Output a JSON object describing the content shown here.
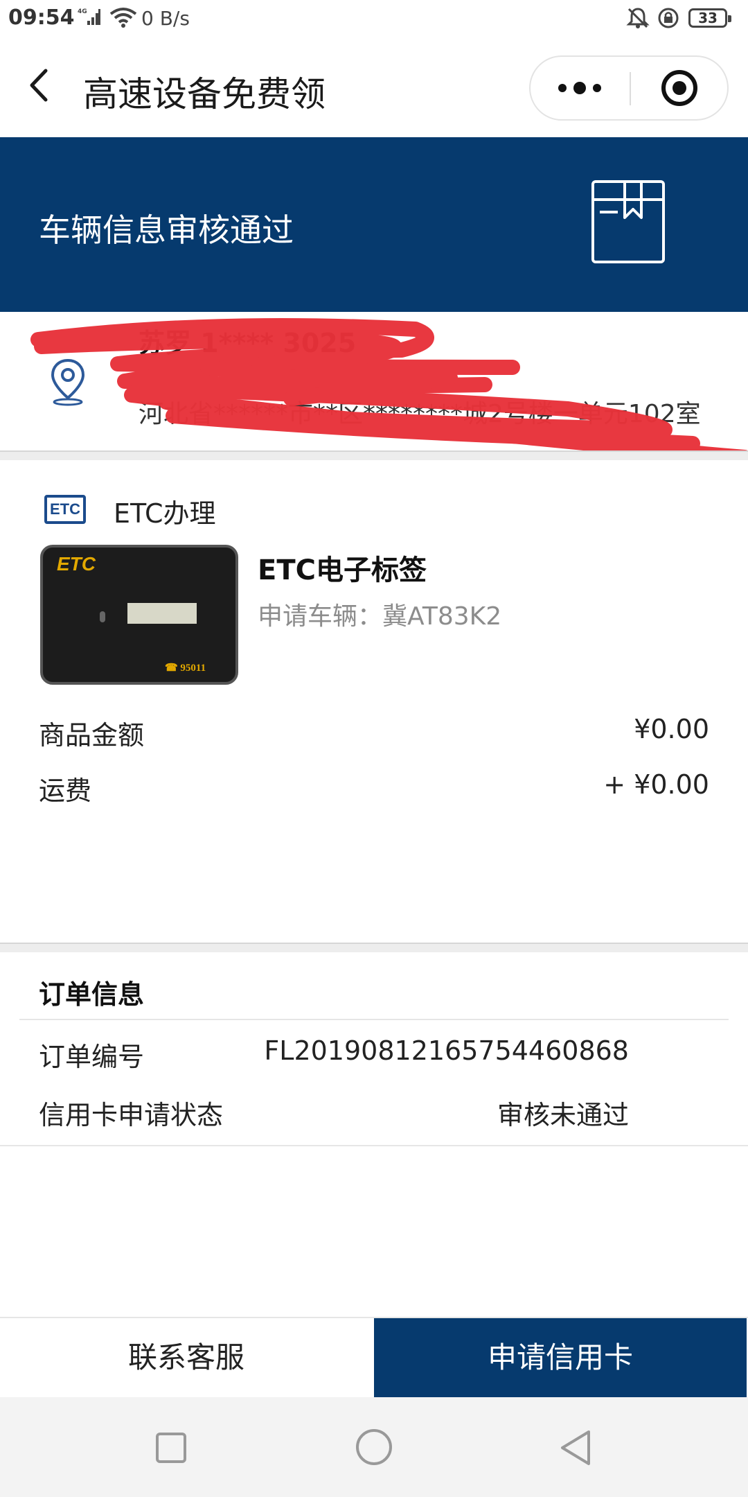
{
  "status_bar": {
    "time": "09:54",
    "network": "4G",
    "speed": "0 B/s",
    "battery": "33"
  },
  "title_bar": {
    "title": "高速设备免费领"
  },
  "banner": {
    "status_text": "车辆信息审核通过"
  },
  "address": {
    "name": "苏罗 1**** 3025",
    "detail": "河北省******市**区********城2号楼一单元102室"
  },
  "product": {
    "shop_name": "ETC办理",
    "shop_logo_text": "ETC",
    "image_logo_text": "ETC",
    "image_phone_text": "☎ 95011",
    "name": "ETC电子标签",
    "vehicle": "申请车辆：冀AT83K2",
    "rows": [
      {
        "label": "商品金额",
        "value": "¥0.00"
      },
      {
        "label": "运费",
        "value": "+ ¥0.00"
      }
    ]
  },
  "order": {
    "title": "订单信息",
    "rows": [
      {
        "label": "订单编号",
        "value": "FL2019081216575446086​8"
      },
      {
        "label": "信用卡申请状态",
        "value": "审核未通过"
      }
    ]
  },
  "actions": {
    "contact": "联系客服",
    "apply": "申请信用卡"
  },
  "colors": {
    "brand": "#063a6e",
    "redaction": "#e8323a"
  }
}
